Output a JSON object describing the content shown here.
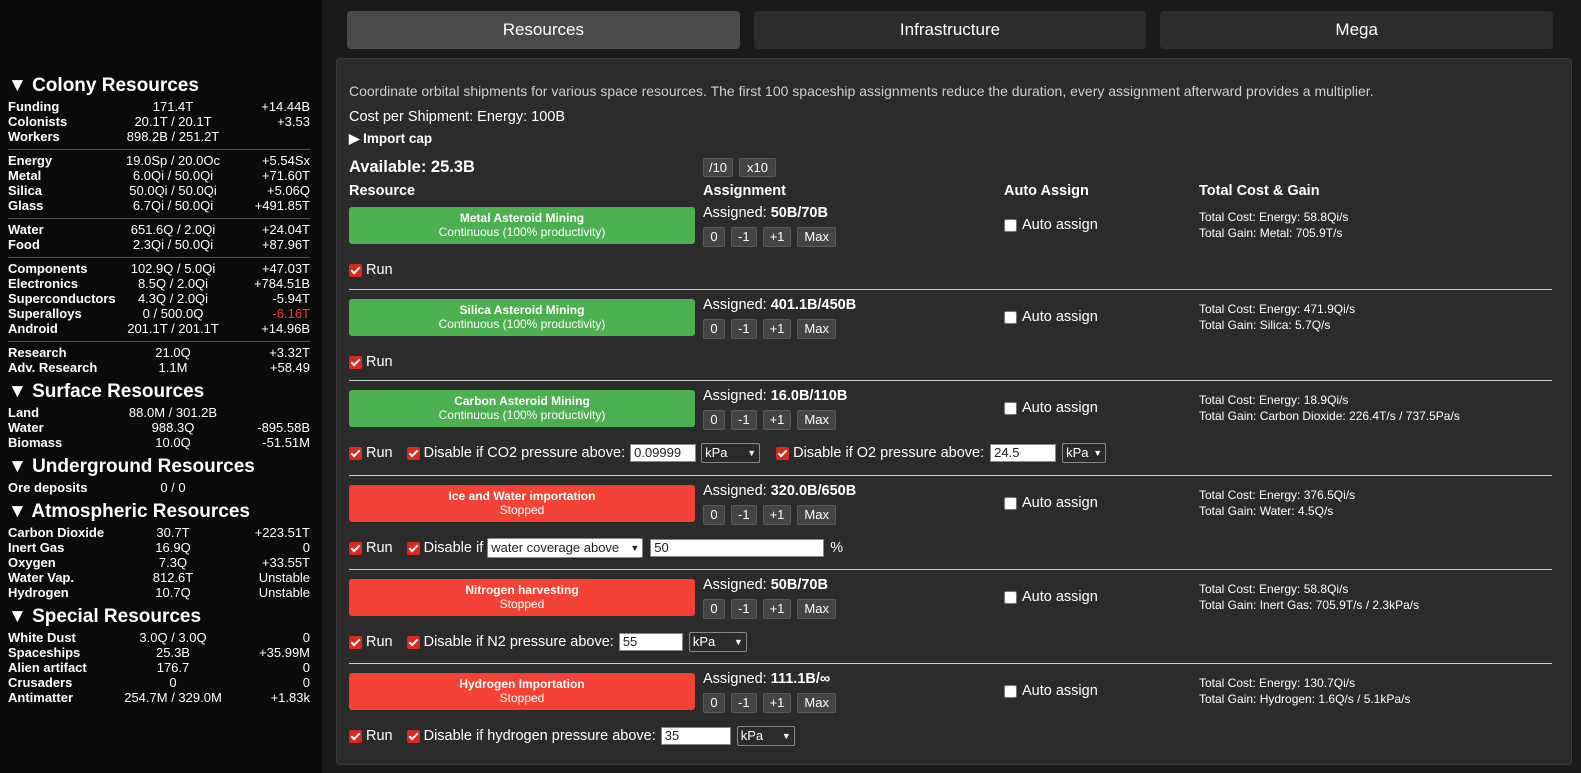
{
  "sidebar": {
    "sections": [
      {
        "title": "▼ Colony Resources",
        "groups": [
          [
            {
              "name": "Funding",
              "value": "171.4T",
              "rate": "+14.44B"
            },
            {
              "name": "Colonists",
              "value": "20.1T / 20.1T",
              "rate": "+3.53"
            },
            {
              "name": "Workers",
              "value": "898.2B / 251.2T",
              "rate": ""
            }
          ],
          [
            {
              "name": "Energy",
              "value": "19.0Sp / 20.0Oc",
              "rate": "+5.54Sx"
            },
            {
              "name": "Metal",
              "value": "6.0Qi / 50.0Qi",
              "rate": "+71.60T"
            },
            {
              "name": "Silica",
              "value": "50.0Qi / 50.0Qi",
              "rate": "+5.06Q"
            },
            {
              "name": "Glass",
              "value": "6.7Qi / 50.0Qi",
              "rate": "+491.85T"
            }
          ],
          [
            {
              "name": "Water",
              "value": "651.6Q / 2.0Qi",
              "rate": "+24.04T"
            },
            {
              "name": "Food",
              "value": "2.3Qi / 50.0Qi",
              "rate": "+87.96T"
            }
          ],
          [
            {
              "name": "Components",
              "value": "102.9Q / 5.0Qi",
              "rate": "+47.03T"
            },
            {
              "name": "Electronics",
              "value": "8.5Q / 2.0Qi",
              "rate": "+784.51B"
            },
            {
              "name": "Superconductors",
              "value": "4.3Q / 2.0Qi",
              "rate": "-5.94T"
            },
            {
              "name": "Superalloys",
              "value": "0 / 500.0Q",
              "rate": "-6.16T",
              "neg": true
            },
            {
              "name": "Android",
              "value": "201.1T / 201.1T",
              "rate": "+14.96B"
            }
          ],
          [
            {
              "name": "Research",
              "value": "21.0Q",
              "rate": "+3.32T"
            },
            {
              "name": "Adv. Research",
              "value": "1.1M",
              "rate": "+58.49"
            }
          ]
        ]
      },
      {
        "title": "▼ Surface Resources",
        "groups": [
          [
            {
              "name": "Land",
              "value": "88.0M / 301.2B",
              "rate": ""
            },
            {
              "name": "Water",
              "value": "988.3Q",
              "rate": "-895.58B"
            },
            {
              "name": "Biomass",
              "value": "10.0Q",
              "rate": "-51.51M"
            }
          ]
        ]
      },
      {
        "title": "▼ Underground Resources",
        "groups": [
          [
            {
              "name": "Ore deposits",
              "value": "0 / 0",
              "rate": ""
            }
          ]
        ]
      },
      {
        "title": "▼ Atmospheric Resources",
        "groups": [
          [
            {
              "name": "Carbon Dioxide",
              "value": "30.7T",
              "rate": "+223.51T"
            },
            {
              "name": "Inert Gas",
              "value": "16.9Q",
              "rate": "0"
            },
            {
              "name": "Oxygen",
              "value": "7.3Q",
              "rate": "+33.55T"
            },
            {
              "name": "Water Vap.",
              "value": "812.6T",
              "rate": "Unstable"
            },
            {
              "name": "Hydrogen",
              "value": "10.7Q",
              "rate": "Unstable"
            }
          ]
        ]
      },
      {
        "title": "▼ Special Resources",
        "groups": [
          [
            {
              "name": "White Dust",
              "value": "3.0Q / 3.0Q",
              "rate": "0"
            },
            {
              "name": "Spaceships",
              "value": "25.3B",
              "rate": "+35.99M"
            },
            {
              "name": "Alien artifact",
              "value": "176.7",
              "rate": "0"
            },
            {
              "name": "Crusaders",
              "value": "0",
              "rate": "0"
            },
            {
              "name": "Antimatter",
              "value": "254.7M / 329.0M",
              "rate": "+1.83k"
            }
          ]
        ]
      }
    ]
  },
  "tabs": [
    "Resources",
    "Infrastructure",
    "Mega"
  ],
  "panel": {
    "description": "Coordinate orbital shipments for various space resources. The first 100 spaceship assignments reduce the duration, every assignment afterward provides a multiplier.",
    "cost": "Cost per Shipment: Energy: 100B",
    "import_cap": "▶ Import cap",
    "available": "Available: 25.3B",
    "div_btn": "/10",
    "mul_btn": "x10",
    "headers": {
      "resource": "Resource",
      "assignment": "Assignment",
      "auto": "Auto Assign",
      "total": "Total Cost & Gain"
    },
    "assigned_label": "Assigned:",
    "auto_label": "Auto assign",
    "run_label": "Run",
    "buttons": [
      "0",
      "-1",
      "+1",
      "Max"
    ],
    "projects": [
      {
        "name": "Metal Asteroid Mining",
        "status": "Continuous (100% productivity)",
        "assigned": "50B/70B",
        "cost": "Total Cost: Energy: 58.8Qi/s",
        "gain": "Total Gain: Metal: 705.9T/s"
      },
      {
        "name": "Silica Asteroid Mining",
        "status": "Continuous (100% productivity)",
        "assigned": "401.1B/450B",
        "cost": "Total Cost: Energy: 471.9Qi/s",
        "gain": "Total Gain: Silica: 5.7Q/s"
      },
      {
        "name": "Carbon Asteroid Mining",
        "status": "Continuous (100% productivity)",
        "assigned": "16.0B/110B",
        "cost": "Total Cost: Energy: 18.9Qi/s",
        "gain": "Total Gain: Carbon Dioxide: 226.4T/s / 737.5Pa/s",
        "co2_label": "Disable if CO2 pressure above:",
        "co2_value": "0.09999",
        "co2_unit": "kPa",
        "o2_label": "Disable if O2 pressure above:",
        "o2_value": "24.5",
        "o2_unit": "kPa"
      },
      {
        "name": "Ice and Water importation",
        "status": "Stopped",
        "assigned": "320.0B/650B",
        "cost": "Total Cost: Energy: 376.5Qi/s",
        "gain": "Total Gain: Water: 4.5Q/s",
        "disable_label": "Disable if",
        "select_value": "water coverage above",
        "input_value": "50",
        "unit": "%"
      },
      {
        "name": "Nitrogen harvesting",
        "status": "Stopped",
        "assigned": "50B/70B",
        "cost": "Total Cost: Energy: 58.8Qi/s",
        "gain": "Total Gain: Inert Gas: 705.9T/s / 2.3kPa/s",
        "disable_label": "Disable if N2 pressure above:",
        "input_value": "55",
        "unit": "kPa"
      },
      {
        "name": "Hydrogen Importation",
        "status": "Stopped",
        "assigned": "111.1B/∞",
        "cost": "Total Cost: Energy: 130.7Qi/s",
        "gain": "Total Gain: Hydrogen: 1.6Q/s / 5.1kPa/s",
        "disable_label": "Disable if hydrogen pressure above:",
        "input_value": "35",
        "unit": "kPa"
      }
    ]
  }
}
